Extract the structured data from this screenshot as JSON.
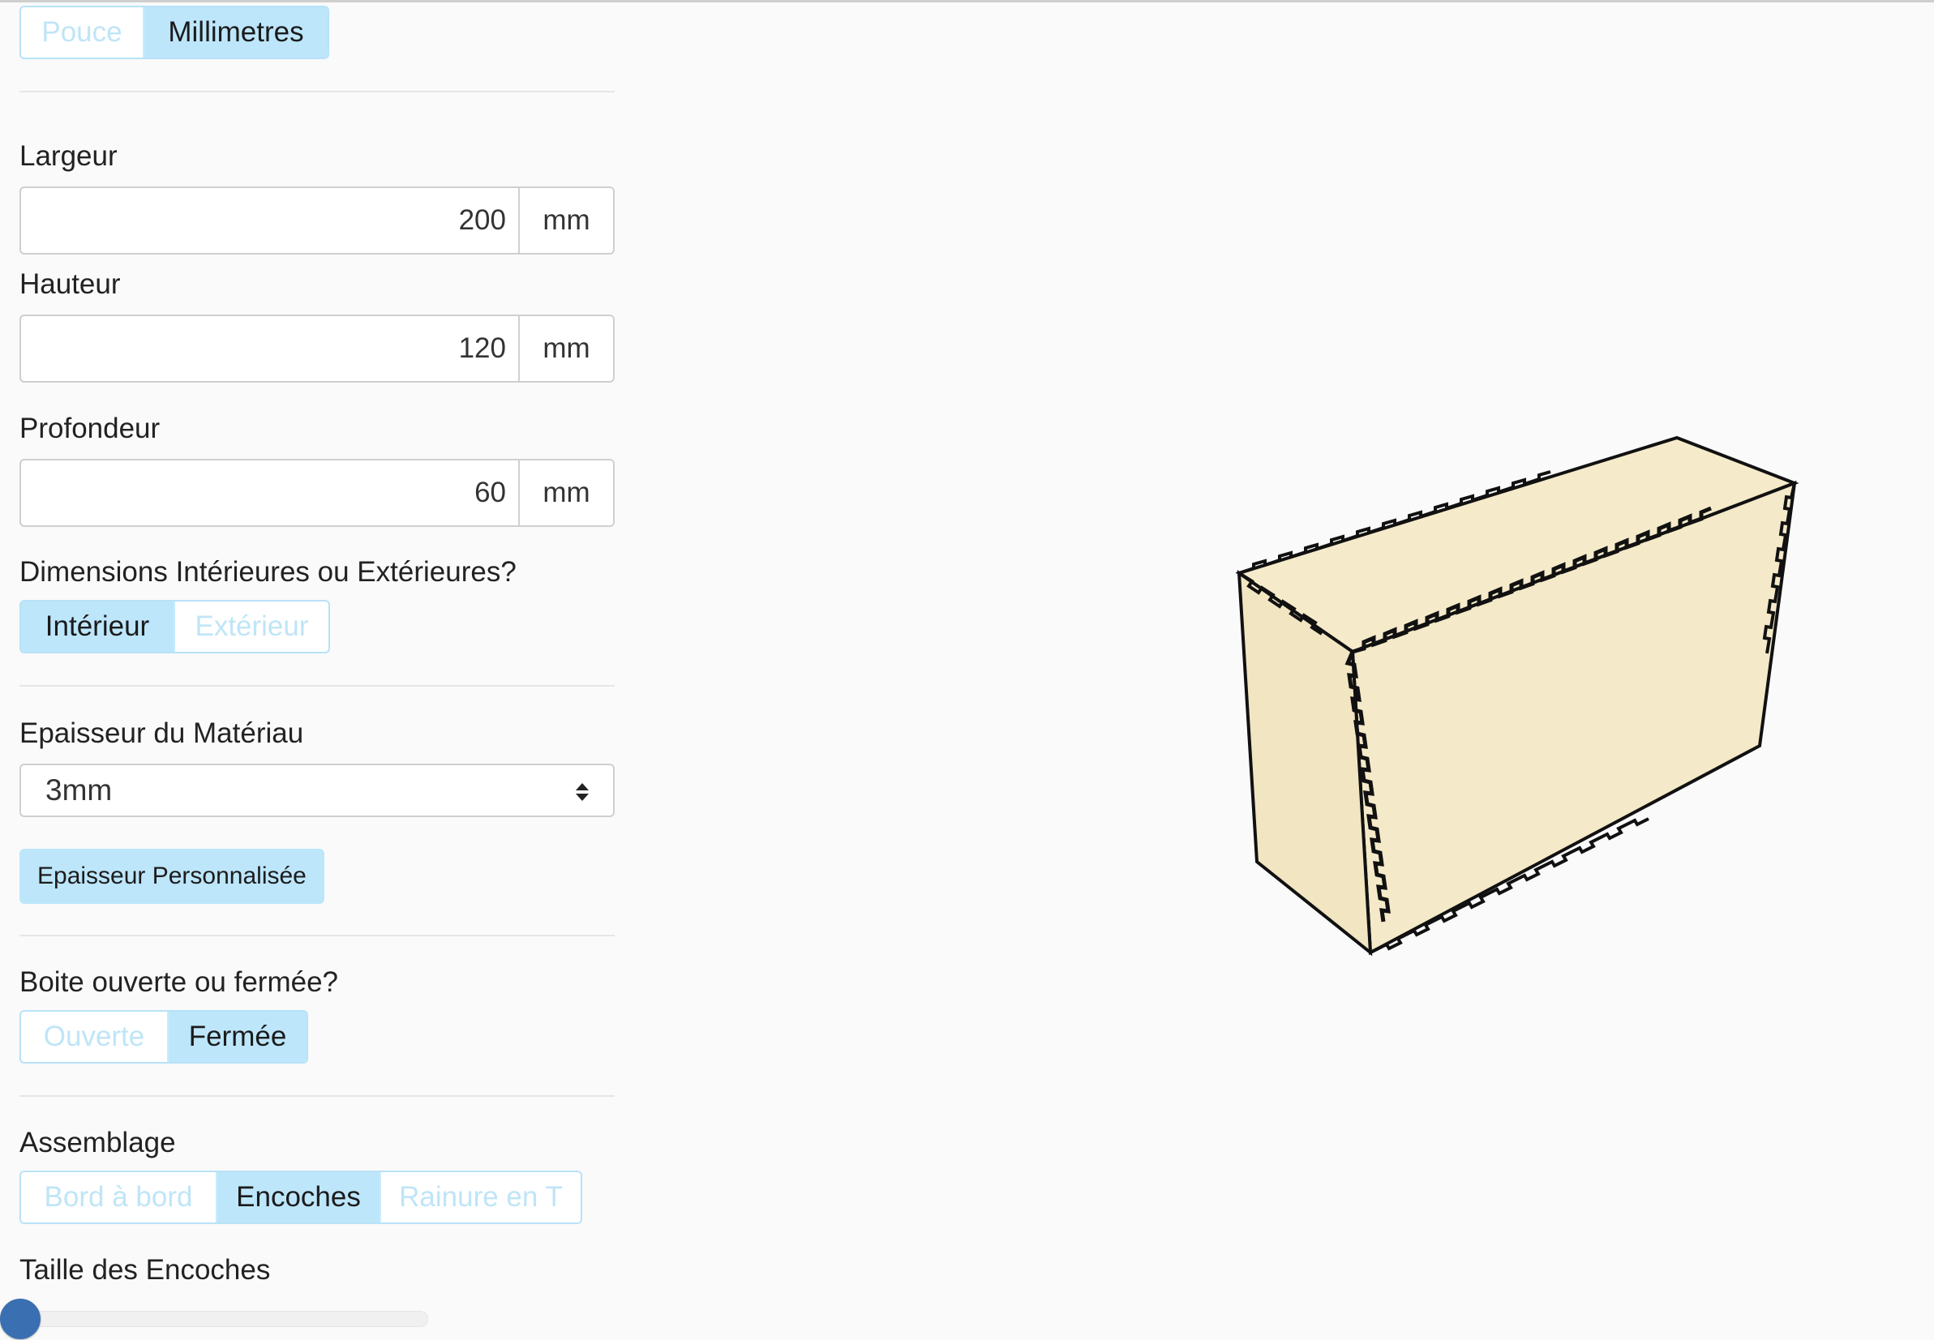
{
  "units": {
    "options": [
      "Pouce",
      "Millimetres"
    ],
    "selected": "Millimetres"
  },
  "width": {
    "label": "Largeur",
    "value": "200",
    "unit": "mm"
  },
  "height": {
    "label": "Hauteur",
    "value": "120",
    "unit": "mm"
  },
  "depth": {
    "label": "Profondeur",
    "value": "60",
    "unit": "mm"
  },
  "dimension_mode": {
    "label": "Dimensions Intérieures ou Extérieures?",
    "options": [
      "Intérieur",
      "Extérieur"
    ],
    "selected": "Intérieur"
  },
  "material": {
    "label": "Epaisseur du Matériau",
    "value": "3mm",
    "custom_button": "Epaisseur Personnalisée"
  },
  "box_type": {
    "label": "Boite ouverte ou fermée?",
    "options": [
      "Ouverte",
      "Fermée"
    ],
    "selected": "Fermée"
  },
  "assembly": {
    "label": "Assemblage",
    "options": [
      "Bord à bord",
      "Encoches",
      "Rainure en T"
    ],
    "selected": "Encoches"
  },
  "notch_size": {
    "label": "Taille des Encoches",
    "level": 0
  },
  "colors": {
    "accent": "#bde6fb",
    "slider": "#3a6fb1",
    "box_fill": "#f5eaca",
    "box_outline": "#111111"
  }
}
